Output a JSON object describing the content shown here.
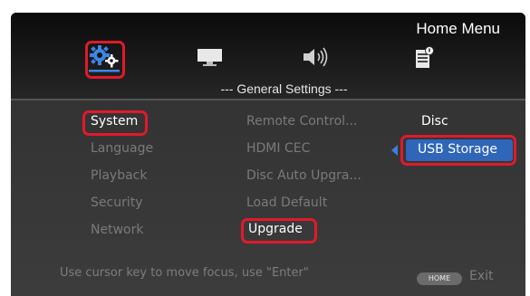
{
  "header": {
    "title": "Home Menu",
    "tabs": [
      {
        "icon": "settings-gears-icon"
      },
      {
        "icon": "display-monitor-icon"
      },
      {
        "icon": "speaker-audio-icon"
      },
      {
        "icon": "document-info-icon"
      }
    ]
  },
  "section_title": "--- General Settings ---",
  "menu": {
    "column1": [
      "System",
      "Language",
      "Playback",
      "Security",
      "Network"
    ],
    "column2": [
      "Remote Control...",
      "HDMI CEC",
      "Disc Auto Upgra...",
      "Load Default",
      "Upgrade"
    ],
    "column3": [
      "Disc",
      "USB Storage"
    ]
  },
  "footer": {
    "hint_line1": "Use cursor key to move focus, use \"Enter\"",
    "hint_line2": "",
    "home_badge": "HOME",
    "exit_label": "Exit"
  },
  "colors": {
    "highlight_border": "#e01a2b",
    "selected_bg": "#2f66b9",
    "dim_text": "#7a7a7a"
  }
}
